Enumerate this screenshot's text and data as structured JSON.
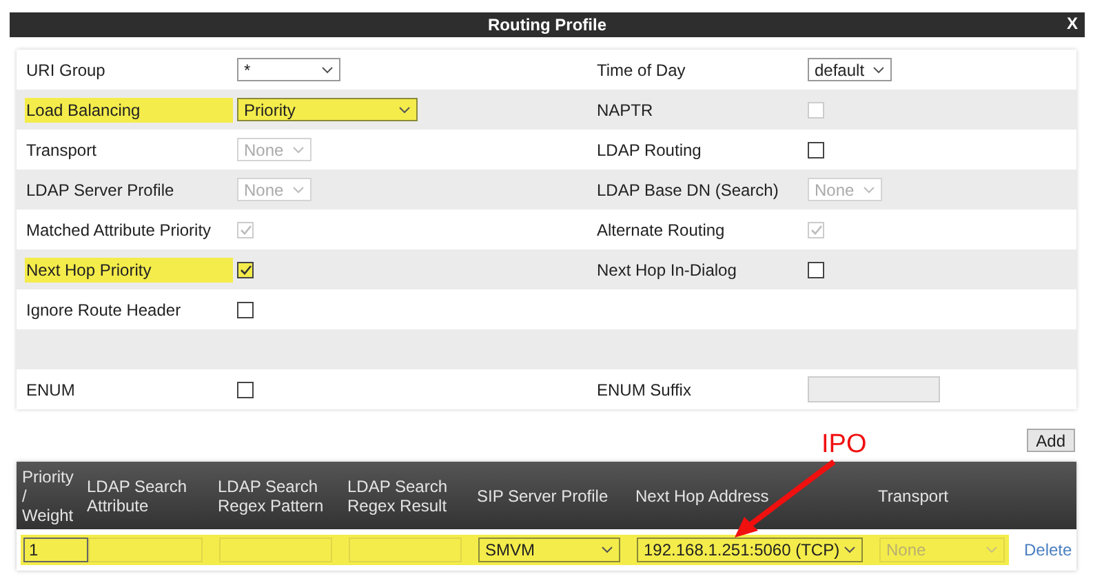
{
  "window": {
    "title": "Routing Profile",
    "close": "X"
  },
  "form_rows": [
    {
      "left": {
        "label": "URI Group",
        "kind": "select",
        "value": "*",
        "disabled": false,
        "highlighted": false
      },
      "right": {
        "label": "Time of Day",
        "kind": "select",
        "value": "default",
        "disabled": false,
        "highlighted": false
      }
    },
    {
      "left": {
        "label": "Load Balancing",
        "kind": "select",
        "value": "Priority",
        "disabled": false,
        "highlighted": true
      },
      "right": {
        "label": "NAPTR",
        "kind": "checkbox",
        "checked": false,
        "disabled": true,
        "highlighted": false
      }
    },
    {
      "left": {
        "label": "Transport",
        "kind": "select",
        "value": "None",
        "disabled": true,
        "highlighted": false
      },
      "right": {
        "label": "LDAP Routing",
        "kind": "checkbox",
        "checked": false,
        "disabled": false,
        "highlighted": false
      }
    },
    {
      "left": {
        "label": "LDAP Server Profile",
        "kind": "select",
        "value": "None",
        "disabled": true,
        "highlighted": false
      },
      "right": {
        "label": "LDAP Base DN (Search)",
        "kind": "select",
        "value": "None",
        "disabled": true,
        "highlighted": false
      }
    },
    {
      "left": {
        "label": "Matched Attribute Priority",
        "kind": "checkbox",
        "checked": true,
        "disabled": true,
        "highlighted": false
      },
      "right": {
        "label": "Alternate Routing",
        "kind": "checkbox",
        "checked": true,
        "disabled": true,
        "highlighted": false
      }
    },
    {
      "left": {
        "label": "Next Hop Priority",
        "kind": "checkbox",
        "checked": true,
        "disabled": false,
        "highlighted": true
      },
      "right": {
        "label": "Next Hop In-Dialog",
        "kind": "checkbox",
        "checked": false,
        "disabled": false,
        "highlighted": false
      }
    },
    {
      "left": {
        "label": "Ignore Route Header",
        "kind": "checkbox",
        "checked": false,
        "disabled": false,
        "highlighted": false
      }
    },
    {},
    {
      "left": {
        "label": "ENUM",
        "kind": "checkbox",
        "checked": false,
        "disabled": false,
        "highlighted": false
      },
      "right": {
        "label": "ENUM Suffix",
        "kind": "text",
        "disabled": true,
        "highlighted": false
      }
    }
  ],
  "add_button": "Add",
  "table": {
    "columns": [
      "Priority / Weight",
      "LDAP Search Attribute",
      "LDAP Search Regex Pattern",
      "LDAP Search Regex Result",
      "SIP Server Profile",
      "Next Hop Address",
      "Transport"
    ],
    "rows": [
      {
        "highlighted": true,
        "cells": [
          {
            "kind": "text",
            "value": "1"
          },
          {
            "kind": "text"
          },
          {
            "kind": "text"
          },
          {
            "kind": "text"
          },
          {
            "kind": "select",
            "value": "SMVM"
          },
          {
            "kind": "select",
            "value": "192.168.1.251:5060 (TCP)"
          },
          {
            "kind": "select",
            "value": "None",
            "disabled": true
          }
        ],
        "action": "Delete"
      }
    ]
  },
  "annotation": {
    "label": "IPO"
  }
}
